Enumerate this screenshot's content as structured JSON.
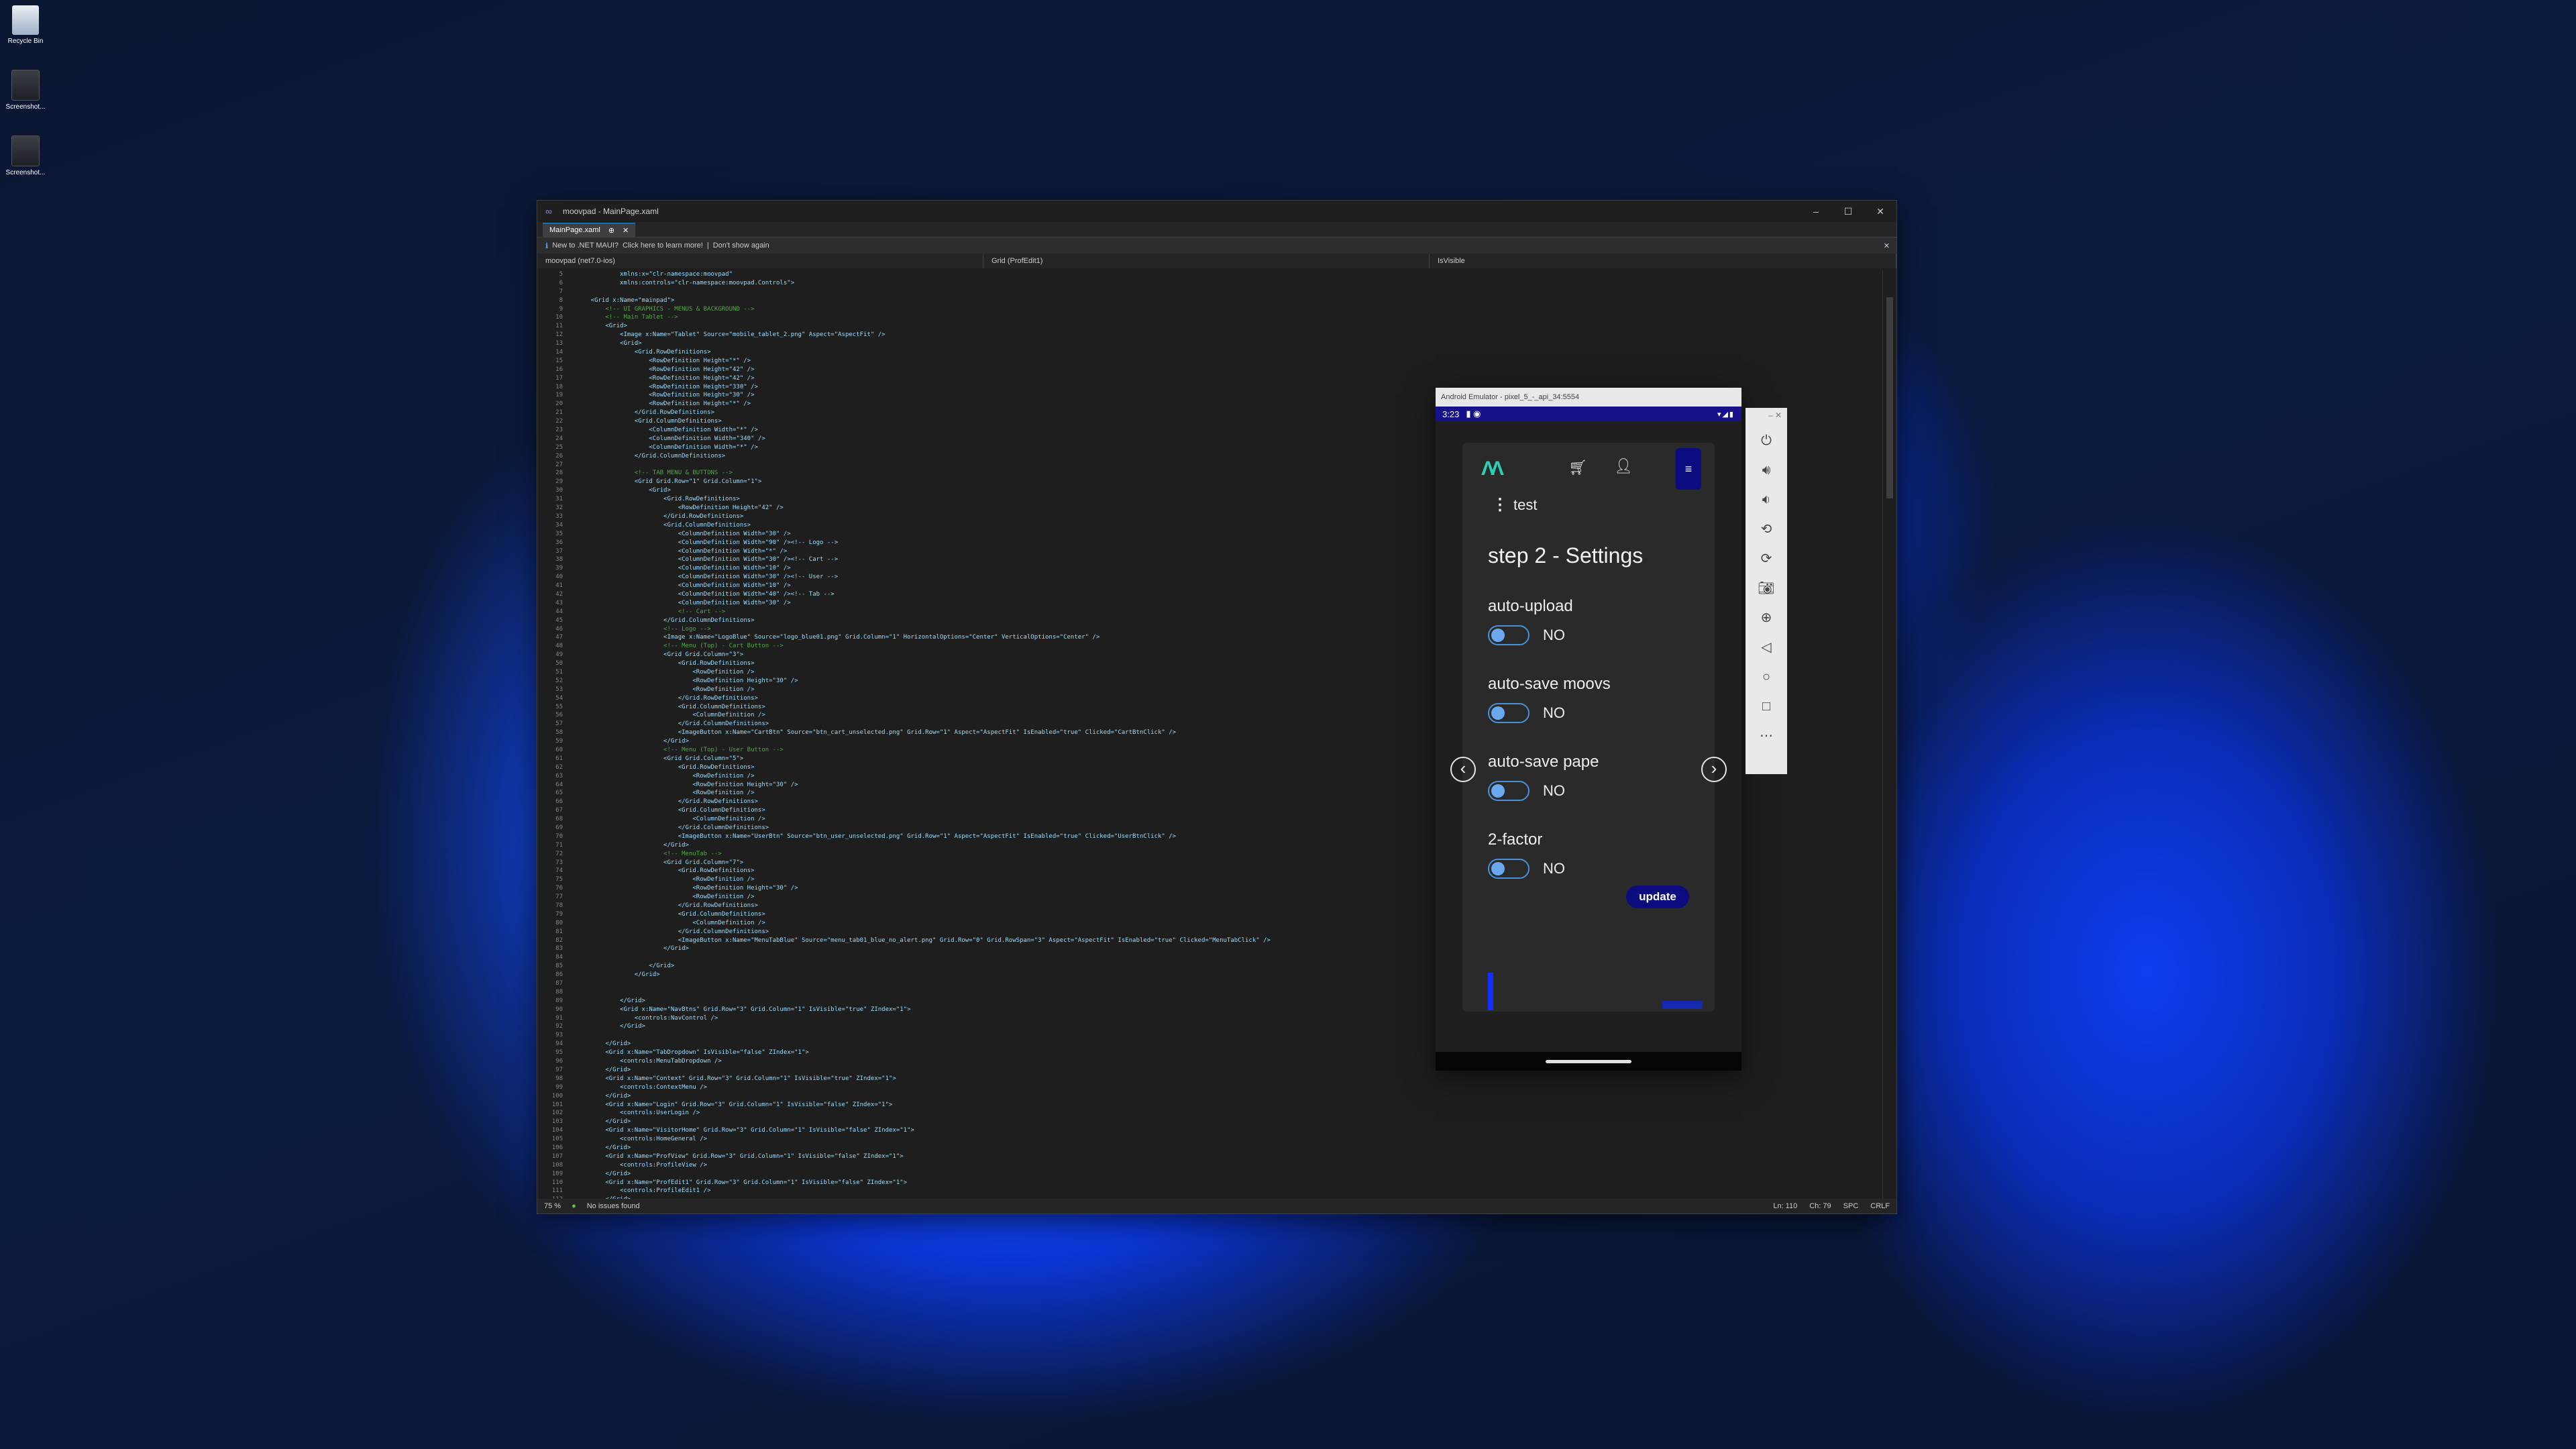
{
  "desktop": {
    "icons": [
      {
        "label": "Recycle Bin"
      },
      {
        "label": "Screenshot..."
      },
      {
        "label": "Screenshot..."
      }
    ]
  },
  "vs": {
    "title": "moovpad - MainPage.xaml",
    "tab": "MainPage.xaml",
    "infobar": {
      "text": "New to .NET MAUI?",
      "learn_more": "Click here to learn more!",
      "dismiss": "Don't show again"
    },
    "nav": {
      "project": "moovpad (net7.0-ios)",
      "scope": "Grid (ProfEdit1)",
      "member": "IsVisible"
    },
    "status": {
      "zoom": "75 %",
      "issues": "No issues found",
      "line": "Ln: 110",
      "col": "Ch: 79",
      "spc": "SPC",
      "eol": "CRLF"
    },
    "code_lines": [
      {
        "n": "5",
        "t": "            xmlns:x=\"clr-namespace:moovpad\"",
        "c": false
      },
      {
        "n": "6",
        "t": "            xmlns:controls=\"clr-namespace:moovpad.Controls\">",
        "c": false
      },
      {
        "n": "7",
        "t": "",
        "c": false
      },
      {
        "n": "8",
        "t": "    <Grid x:Name=\"mainpad\">",
        "c": false
      },
      {
        "n": "9",
        "t": "        <!-- UI GRAPHICS - MENUS & BACKGROUND -->",
        "c": true
      },
      {
        "n": "10",
        "t": "        <!-- Main Tablet -->",
        "c": true
      },
      {
        "n": "11",
        "t": "        <Grid>",
        "c": false
      },
      {
        "n": "12",
        "t": "            <Image x:Name=\"Tablet\" Source=\"mobile_tablet_2.png\" Aspect=\"AspectFit\" />",
        "c": false
      },
      {
        "n": "13",
        "t": "            <Grid>",
        "c": false
      },
      {
        "n": "14",
        "t": "                <Grid.RowDefinitions>",
        "c": false
      },
      {
        "n": "15",
        "t": "                    <RowDefinition Height=\"*\" />",
        "c": false
      },
      {
        "n": "16",
        "t": "                    <RowDefinition Height=\"42\" />",
        "c": false
      },
      {
        "n": "17",
        "t": "                    <RowDefinition Height=\"42\" />",
        "c": false
      },
      {
        "n": "18",
        "t": "                    <RowDefinition Height=\"330\" />",
        "c": false
      },
      {
        "n": "19",
        "t": "                    <RowDefinition Height=\"30\" />",
        "c": false
      },
      {
        "n": "20",
        "t": "                    <RowDefinition Height=\"*\" />",
        "c": false
      },
      {
        "n": "21",
        "t": "                </Grid.RowDefinitions>",
        "c": false
      },
      {
        "n": "22",
        "t": "                <Grid.ColumnDefinitions>",
        "c": false
      },
      {
        "n": "23",
        "t": "                    <ColumnDefinition Width=\"*\" />",
        "c": false
      },
      {
        "n": "24",
        "t": "                    <ColumnDefinition Width=\"340\" />",
        "c": false
      },
      {
        "n": "25",
        "t": "                    <ColumnDefinition Width=\"*\" />",
        "c": false
      },
      {
        "n": "26",
        "t": "                </Grid.ColumnDefinitions>",
        "c": false
      },
      {
        "n": "27",
        "t": "",
        "c": false
      },
      {
        "n": "28",
        "t": "                <!-- TAB MENU & BUTTONS -->",
        "c": true
      },
      {
        "n": "29",
        "t": "                <Grid Grid.Row=\"1\" Grid.Column=\"1\">",
        "c": false
      },
      {
        "n": "30",
        "t": "                    <Grid>",
        "c": false
      },
      {
        "n": "31",
        "t": "                        <Grid.RowDefinitions>",
        "c": false
      },
      {
        "n": "32",
        "t": "                            <RowDefinition Height=\"42\" />",
        "c": false
      },
      {
        "n": "33",
        "t": "                        </Grid.RowDefinitions>",
        "c": false
      },
      {
        "n": "34",
        "t": "                        <Grid.ColumnDefinitions>",
        "c": false
      },
      {
        "n": "35",
        "t": "                            <ColumnDefinition Width=\"30\" />",
        "c": false
      },
      {
        "n": "36",
        "t": "                            <ColumnDefinition Width=\"90\" /><!-- Logo -->",
        "c": false
      },
      {
        "n": "37",
        "t": "                            <ColumnDefinition Width=\"*\" />",
        "c": false
      },
      {
        "n": "38",
        "t": "                            <ColumnDefinition Width=\"30\" /><!-- Cart -->",
        "c": false
      },
      {
        "n": "39",
        "t": "                            <ColumnDefinition Width=\"10\" />",
        "c": false
      },
      {
        "n": "40",
        "t": "                            <ColumnDefinition Width=\"30\" /><!-- User -->",
        "c": false
      },
      {
        "n": "41",
        "t": "                            <ColumnDefinition Width=\"10\" />",
        "c": false
      },
      {
        "n": "42",
        "t": "                            <ColumnDefinition Width=\"40\" /><!-- Tab -->",
        "c": false
      },
      {
        "n": "43",
        "t": "                            <ColumnDefinition Width=\"30\" />",
        "c": false
      },
      {
        "n": "44",
        "t": "                            <!-- Cart -->",
        "c": true
      },
      {
        "n": "45",
        "t": "                        </Grid.ColumnDefinitions>",
        "c": false
      },
      {
        "n": "46",
        "t": "                        <!-- Logo -->",
        "c": true
      },
      {
        "n": "47",
        "t": "                        <Image x:Name=\"LogoBlue\" Source=\"logo_blue01.png\" Grid.Column=\"1\" HorizontalOptions=\"Center\" VerticalOptions=\"Center\" />",
        "c": false
      },
      {
        "n": "48",
        "t": "                        <!-- Menu (Top) - Cart Button -->",
        "c": true
      },
      {
        "n": "49",
        "t": "                        <Grid Grid.Column=\"3\">",
        "c": false
      },
      {
        "n": "50",
        "t": "                            <Grid.RowDefinitions>",
        "c": false
      },
      {
        "n": "51",
        "t": "                                <RowDefinition />",
        "c": false
      },
      {
        "n": "52",
        "t": "                                <RowDefinition Height=\"30\" />",
        "c": false
      },
      {
        "n": "53",
        "t": "                                <RowDefinition />",
        "c": false
      },
      {
        "n": "54",
        "t": "                            </Grid.RowDefinitions>",
        "c": false
      },
      {
        "n": "55",
        "t": "                            <Grid.ColumnDefinitions>",
        "c": false
      },
      {
        "n": "56",
        "t": "                                <ColumnDefinition />",
        "c": false
      },
      {
        "n": "57",
        "t": "                            </Grid.ColumnDefinitions>",
        "c": false
      },
      {
        "n": "58",
        "t": "                            <ImageButton x:Name=\"CartBtn\" Source=\"btn_cart_unselected.png\" Grid.Row=\"1\" Aspect=\"AspectFit\" IsEnabled=\"true\" Clicked=\"CartBtnClick\" />",
        "c": false
      },
      {
        "n": "59",
        "t": "                        </Grid>",
        "c": false
      },
      {
        "n": "60",
        "t": "                        <!-- Menu (Top) - User Button -->",
        "c": true
      },
      {
        "n": "61",
        "t": "                        <Grid Grid.Column=\"5\">",
        "c": false
      },
      {
        "n": "62",
        "t": "                            <Grid.RowDefinitions>",
        "c": false
      },
      {
        "n": "63",
        "t": "                                <RowDefinition />",
        "c": false
      },
      {
        "n": "64",
        "t": "                                <RowDefinition Height=\"30\" />",
        "c": false
      },
      {
        "n": "65",
        "t": "                                <RowDefinition />",
        "c": false
      },
      {
        "n": "66",
        "t": "                            </Grid.RowDefinitions>",
        "c": false
      },
      {
        "n": "67",
        "t": "                            <Grid.ColumnDefinitions>",
        "c": false
      },
      {
        "n": "68",
        "t": "                                <ColumnDefinition />",
        "c": false
      },
      {
        "n": "69",
        "t": "                            </Grid.ColumnDefinitions>",
        "c": false
      },
      {
        "n": "70",
        "t": "                            <ImageButton x:Name=\"UserBtn\" Source=\"btn_user_unselected.png\" Grid.Row=\"1\" Aspect=\"AspectFit\" IsEnabled=\"true\" Clicked=\"UserBtnClick\" />",
        "c": false
      },
      {
        "n": "71",
        "t": "                        </Grid>",
        "c": false
      },
      {
        "n": "72",
        "t": "                        <!-- MenuTab -->",
        "c": true
      },
      {
        "n": "73",
        "t": "                        <Grid Grid.Column=\"7\">",
        "c": false
      },
      {
        "n": "74",
        "t": "                            <Grid.RowDefinitions>",
        "c": false
      },
      {
        "n": "75",
        "t": "                                <RowDefinition />",
        "c": false
      },
      {
        "n": "76",
        "t": "                                <RowDefinition Height=\"30\" />",
        "c": false
      },
      {
        "n": "77",
        "t": "                                <RowDefinition />",
        "c": false
      },
      {
        "n": "78",
        "t": "                            </Grid.RowDefinitions>",
        "c": false
      },
      {
        "n": "79",
        "t": "                            <Grid.ColumnDefinitions>",
        "c": false
      },
      {
        "n": "80",
        "t": "                                <ColumnDefinition />",
        "c": false
      },
      {
        "n": "81",
        "t": "                            </Grid.ColumnDefinitions>",
        "c": false
      },
      {
        "n": "82",
        "t": "                            <ImageButton x:Name=\"MenuTabBlue\" Source=\"menu_tab01_blue_no_alert.png\" Grid.Row=\"0\" Grid.RowSpan=\"3\" Aspect=\"AspectFit\" IsEnabled=\"true\" Clicked=\"MenuTabClick\" />",
        "c": false
      },
      {
        "n": "83",
        "t": "                        </Grid>",
        "c": false
      },
      {
        "n": "84",
        "t": "",
        "c": false
      },
      {
        "n": "85",
        "t": "                    </Grid>",
        "c": false
      },
      {
        "n": "86",
        "t": "                </Grid>",
        "c": false
      },
      {
        "n": "87",
        "t": "",
        "c": false
      },
      {
        "n": "88",
        "t": "",
        "c": false
      },
      {
        "n": "89",
        "t": "            </Grid>",
        "c": false
      },
      {
        "n": "90",
        "t": "            <Grid x:Name=\"NavBtns\" Grid.Row=\"3\" Grid.Column=\"1\" IsVisible=\"true\" ZIndex=\"1\">",
        "c": false
      },
      {
        "n": "91",
        "t": "                <controls:NavControl />",
        "c": false
      },
      {
        "n": "92",
        "t": "            </Grid>",
        "c": false
      },
      {
        "n": "93",
        "t": "",
        "c": false
      },
      {
        "n": "94",
        "t": "        </Grid>",
        "c": false
      },
      {
        "n": "95",
        "t": "        <Grid x:Name=\"TabDropdown\" IsVisible=\"false\" ZIndex=\"1\">",
        "c": false
      },
      {
        "n": "96",
        "t": "            <controls:MenuTabDropdown />",
        "c": false
      },
      {
        "n": "97",
        "t": "        </Grid>",
        "c": false
      },
      {
        "n": "98",
        "t": "        <Grid x:Name=\"Context\" Grid.Row=\"3\" Grid.Column=\"1\" IsVisible=\"true\" ZIndex=\"1\">",
        "c": false
      },
      {
        "n": "99",
        "t": "            <controls:ContextMenu />",
        "c": false
      },
      {
        "n": "100",
        "t": "        </Grid>",
        "c": false
      },
      {
        "n": "101",
        "t": "        <Grid x:Name=\"Login\" Grid.Row=\"3\" Grid.Column=\"1\" IsVisible=\"false\" ZIndex=\"1\">",
        "c": false
      },
      {
        "n": "102",
        "t": "            <controls:UserLogin />",
        "c": false
      },
      {
        "n": "103",
        "t": "        </Grid>",
        "c": false
      },
      {
        "n": "104",
        "t": "        <Grid x:Name=\"VisitorHome\" Grid.Row=\"3\" Grid.Column=\"1\" IsVisible=\"false\" ZIndex=\"1\">",
        "c": false
      },
      {
        "n": "105",
        "t": "            <controls:HomeGeneral />",
        "c": false
      },
      {
        "n": "106",
        "t": "        </Grid>",
        "c": false
      },
      {
        "n": "107",
        "t": "        <Grid x:Name=\"ProfView\" Grid.Row=\"3\" Grid.Column=\"1\" IsVisible=\"false\" ZIndex=\"1\">",
        "c": false
      },
      {
        "n": "108",
        "t": "            <controls:ProfileView />",
        "c": false
      },
      {
        "n": "109",
        "t": "        </Grid>",
        "c": false
      },
      {
        "n": "110",
        "t": "        <Grid x:Name=\"ProfEdit1\" Grid.Row=\"3\" Grid.Column=\"1\" IsVisible=\"false\" ZIndex=\"1\">",
        "c": false
      },
      {
        "n": "111",
        "t": "            <controls:ProfileEdit1 />",
        "c": false
      },
      {
        "n": "112",
        "t": "        </Grid>",
        "c": false
      }
    ]
  },
  "emulator": {
    "title": "Android Emulator - pixel_5_-_api_34:5554",
    "time": "3:23",
    "app": {
      "profile_name": "test",
      "step_title": "step 2 - Settings",
      "settings": [
        {
          "label": "auto-upload",
          "value": "NO"
        },
        {
          "label": "auto-save moovs",
          "value": "NO"
        },
        {
          "label": "auto-save pape",
          "value": "NO"
        },
        {
          "label": "2-factor",
          "value": "NO"
        }
      ],
      "update_label": "update"
    }
  }
}
